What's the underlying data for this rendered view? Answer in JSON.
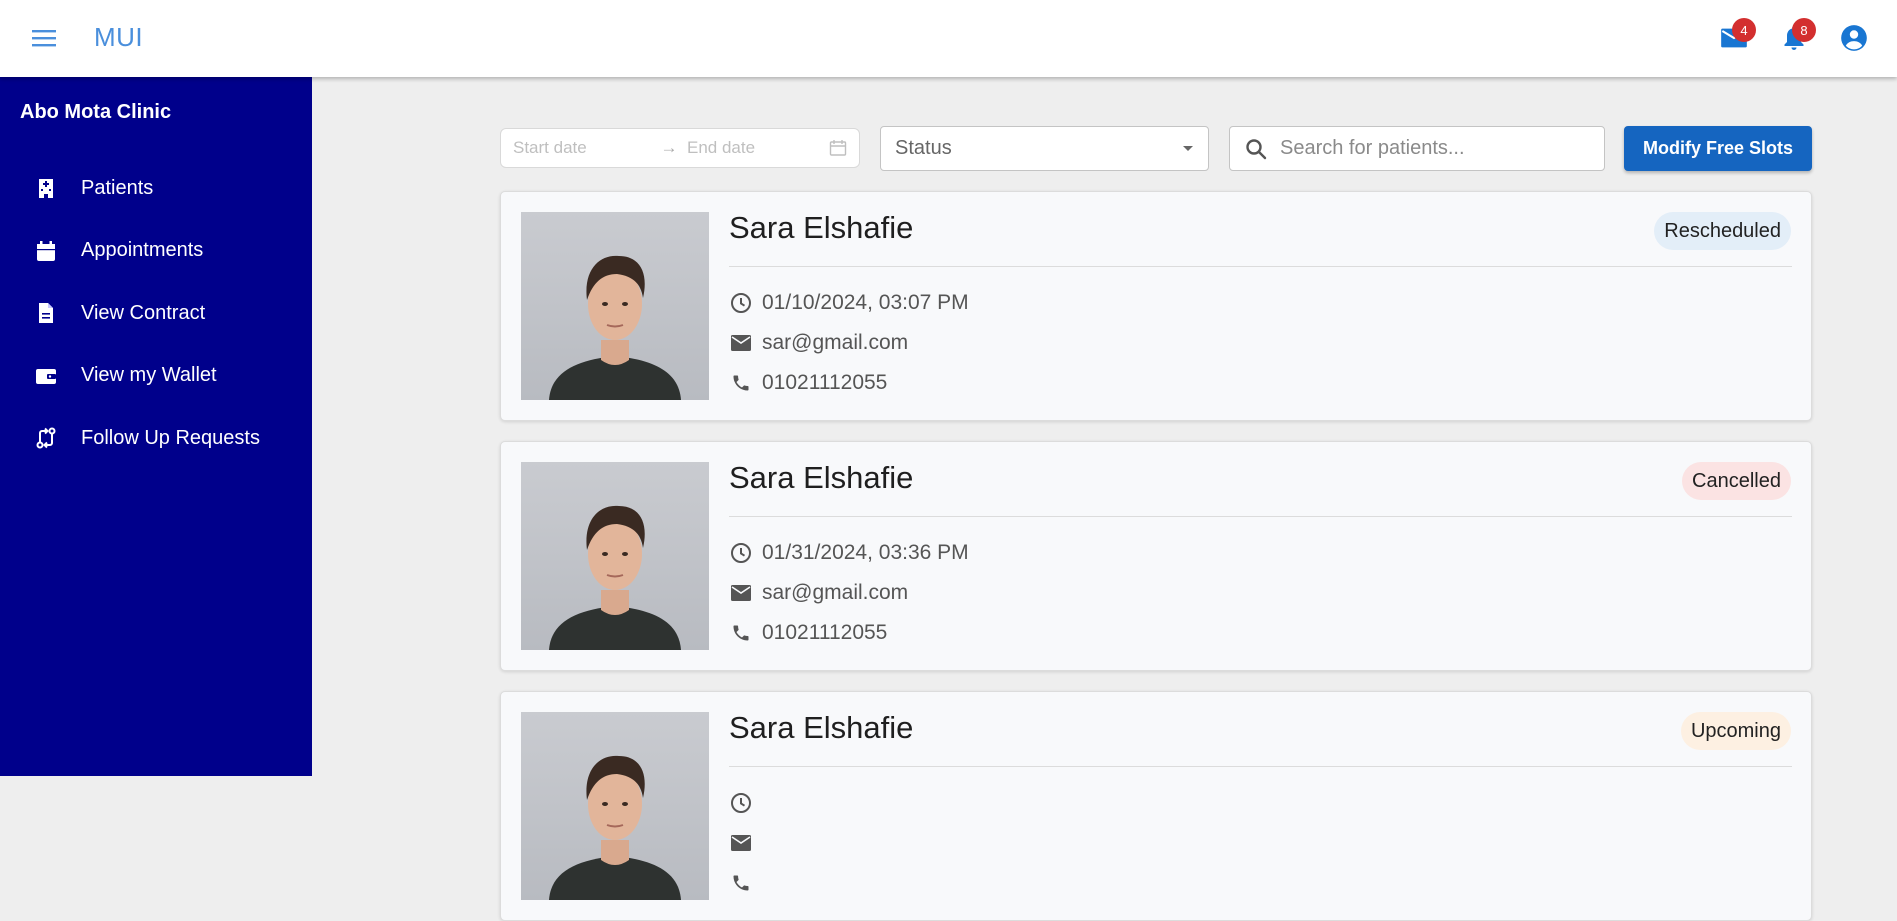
{
  "appbar": {
    "brand": "MUI",
    "mail_badge": "4",
    "notifications_badge": "8",
    "accent_color": "#4a8fdc"
  },
  "sidebar": {
    "title": "Abo Mota Clinic",
    "background": "#00008b",
    "items": [
      {
        "label": "Patients",
        "icon": "hospital-icon"
      },
      {
        "label": "Appointments",
        "icon": "calendar-icon"
      },
      {
        "label": "View Contract",
        "icon": "document-icon"
      },
      {
        "label": "View my Wallet",
        "icon": "wallet-icon"
      },
      {
        "label": "Follow Up Requests",
        "icon": "compare-arrows-icon"
      }
    ]
  },
  "filters": {
    "start_date_placeholder": "Start date",
    "end_date_placeholder": "End date",
    "status_label": "Status",
    "search_placeholder": "Search for patients...",
    "modify_button": "Modify Free Slots"
  },
  "appointments": [
    {
      "name": "Sara Elshafie",
      "status": "Rescheduled",
      "status_color": "#e3eef8",
      "datetime": "01/10/2024, 03:07 PM",
      "email": "sar@gmail.com",
      "phone": "01021112055"
    },
    {
      "name": "Sara Elshafie",
      "status": "Cancelled",
      "status_color": "#fbe3e3",
      "datetime": "01/31/2024, 03:36 PM",
      "email": "sar@gmail.com",
      "phone": "01021112055"
    },
    {
      "name": "Sara Elshafie",
      "status": "Upcoming",
      "status_color": "#fdf0e2",
      "datetime": "",
      "email": "",
      "phone": ""
    }
  ]
}
